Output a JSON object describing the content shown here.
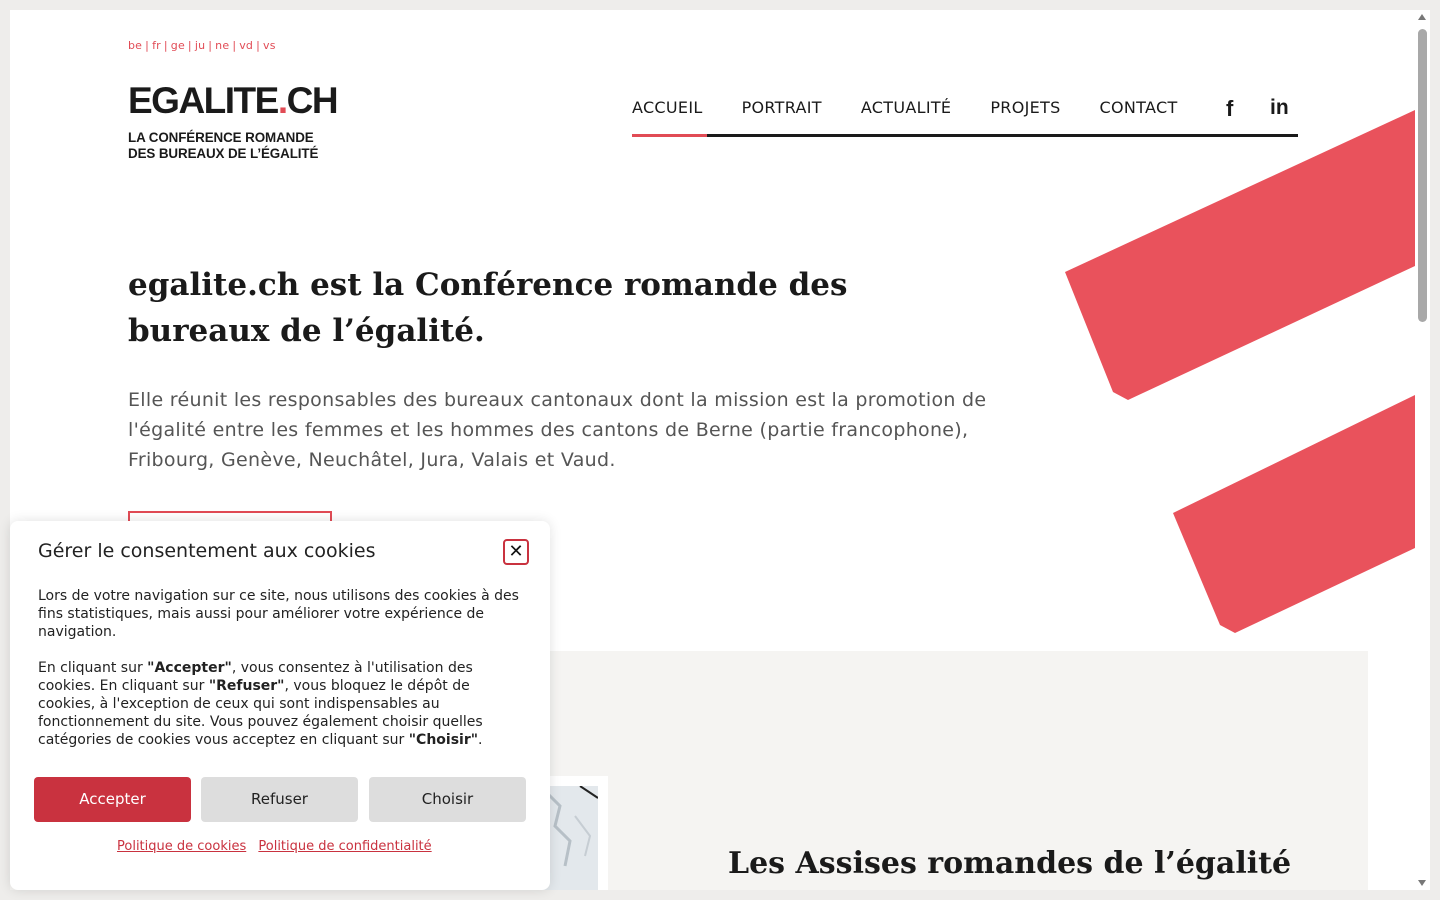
{
  "languages": [
    "be",
    "fr",
    "ge",
    "ju",
    "ne",
    "vd",
    "vs"
  ],
  "logo": {
    "main_prefix": "EGALITE",
    "main_dot": ".",
    "main_suffix": "CH",
    "sub_line1": "LA CONFÉRENCE ROMANDE",
    "sub_line2": "DES BUREAUX DE L’ÉGALITÉ"
  },
  "nav": {
    "items": [
      "ACCUEIL",
      "PORTRAIT",
      "ACTUALITÉ",
      "PROJETS",
      "CONTACT"
    ],
    "active": "ACCUEIL",
    "facebook_glyph": "f",
    "linkedin_glyph": "in"
  },
  "hero": {
    "title": "egalite.ch est la Conférence romande des bureaux de l’égalité.",
    "text": "Elle réunit les responsables des bureaux cantonaux dont la mission est la promotion de l'égalité entre les femmes et les hommes des cantons de Berne (partie francophone), Fribourg, Genève, Neuchâtel, Jura, Valais et Vaud."
  },
  "news": {
    "title": "Les Assises romandes de l’égalité"
  },
  "cookie": {
    "title": "Gérer le consentement aux cookies",
    "close_glyph": "✕",
    "p1": "Lors de votre navigation sur ce site, nous utilisons des cookies à des fins statistiques, mais aussi pour améliorer votre expérience de navigation.",
    "p2_a": "En cliquant sur ",
    "p2_b": "\"Accepter\"",
    "p2_c": ", vous consentez à l'utilisation des cookies. En cliquant sur ",
    "p2_d": "\"Refuser\"",
    "p2_e": ", vous bloquez le dépôt de cookies, à l'exception de ceux qui sont indispensables au fonctionnement du site. Vous pouvez également choisir quelles catégories de cookies vous acceptez en cliquant sur ",
    "p2_f": "\"Choisir\"",
    "p2_g": ".",
    "accept_label": "Accepter",
    "refuse_label": "Refuser",
    "choose_label": "Choisir",
    "link_cookies": "Politique de cookies",
    "link_privacy": "Politique de confidentialité"
  },
  "colors": {
    "accent": "#e14b55",
    "stripe": "#e9525c",
    "button_primary": "#c9323f"
  }
}
